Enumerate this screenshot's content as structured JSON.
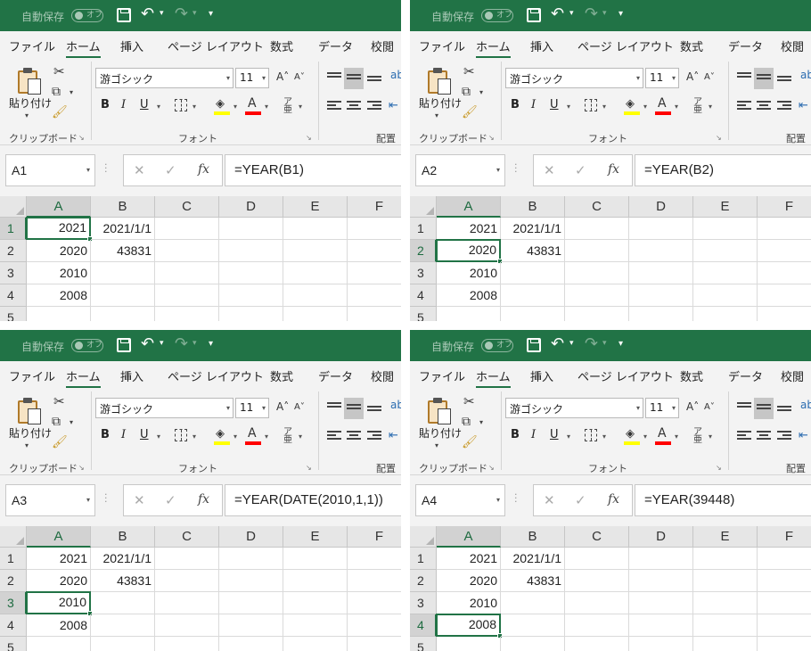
{
  "app": {
    "autosave_label": "自動保存",
    "autosave_toggle": "オフ",
    "tabs": [
      "ファイル",
      "ホーム",
      "挿入",
      "ページ レイアウト",
      "数式",
      "データ",
      "校閲"
    ],
    "active_tab": "ホーム",
    "clipboard_group": {
      "paste_label": "貼り付け",
      "group_label": "クリップボード"
    },
    "font_group": {
      "font_name": "游ゴシック",
      "font_size": "11",
      "group_label": "フォント",
      "fill_color": "#FFFF00",
      "font_color": "#FF0000",
      "phonetic_glyph": "亜"
    },
    "alignment_group": {
      "group_label": "配置"
    },
    "icons": [
      "save-icon",
      "undo-icon",
      "redo-icon",
      "scissors-icon",
      "copy-icon",
      "format-painter-icon",
      "bold-icon",
      "italic-icon",
      "underline-icon",
      "border-icon",
      "fill-color-icon",
      "font-color-icon",
      "grow-font-icon",
      "shrink-font-icon",
      "fx-icon",
      "cancel-icon",
      "enter-icon"
    ],
    "accent_color": "#217346"
  },
  "columns": [
    "A",
    "B",
    "C",
    "D",
    "E",
    "F"
  ],
  "rows": [
    "1",
    "2",
    "3",
    "4",
    "5"
  ],
  "cells": [
    [
      "2021",
      "2021/1/1",
      "",
      "",
      "",
      ""
    ],
    [
      "2020",
      "43831",
      "",
      "",
      "",
      ""
    ],
    [
      "2010",
      "",
      "",
      "",
      "",
      ""
    ],
    [
      "2008",
      "",
      "",
      "",
      "",
      ""
    ],
    [
      "",
      "",
      "",
      "",
      "",
      ""
    ]
  ],
  "panels": [
    {
      "name_box": "A1",
      "formula": "=YEAR(B1)",
      "selected_row": 1,
      "selected_col": "A"
    },
    {
      "name_box": "A2",
      "formula": "=YEAR(B2)",
      "selected_row": 2,
      "selected_col": "A"
    },
    {
      "name_box": "A3",
      "formula": "=YEAR(DATE(2010,1,1))",
      "selected_row": 3,
      "selected_col": "A"
    },
    {
      "name_box": "A4",
      "formula": "=YEAR(39448)",
      "selected_row": 4,
      "selected_col": "A"
    }
  ]
}
